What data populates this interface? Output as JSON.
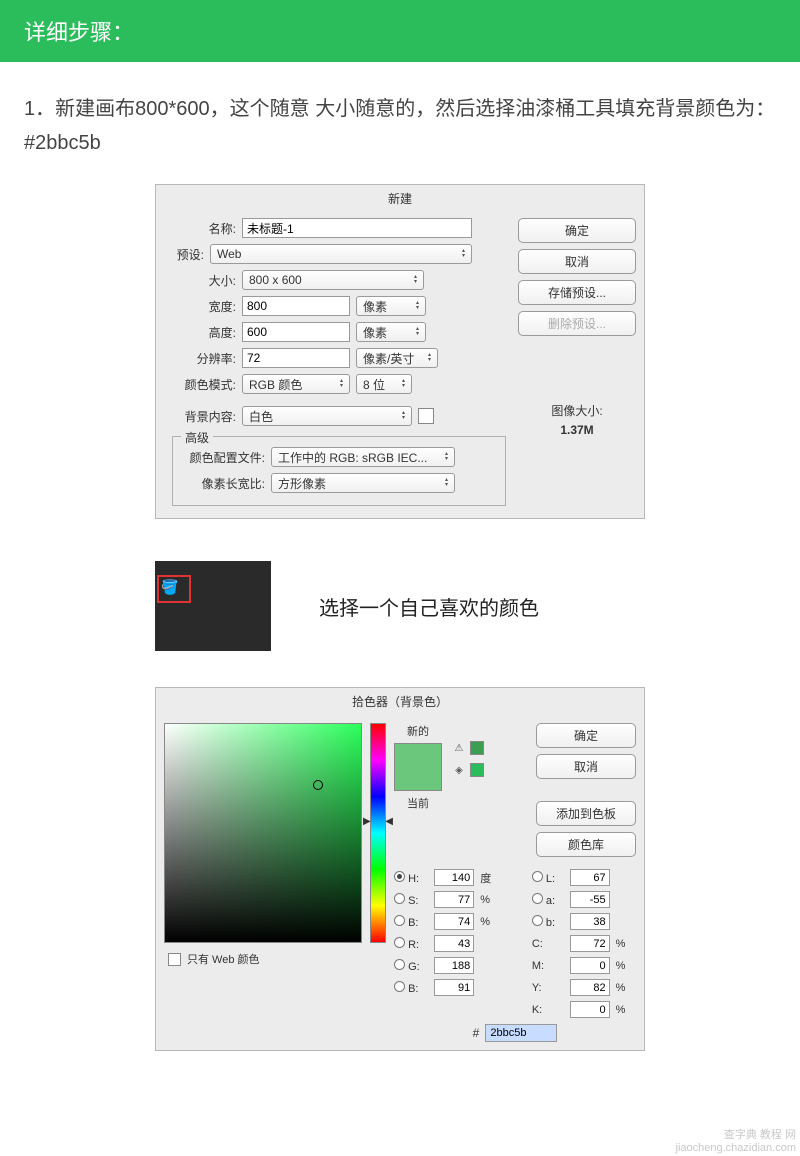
{
  "header": {
    "title": "详细步骤："
  },
  "intro": "1．新建画布800*600，这个随意  大小随意的，然后选择油漆桶工具填充背景颜色为：#2bbc5b",
  "newDialog": {
    "title": "新建",
    "labels": {
      "name": "名称:",
      "preset": "预设:",
      "size": "大小:",
      "width": "宽度:",
      "height": "高度:",
      "res": "分辨率:",
      "mode": "颜色模式:",
      "bg": "背景内容:",
      "advanced": "高级",
      "profile": "颜色配置文件:",
      "aspect": "像素长宽比:",
      "sizeLabel": "图像大小:"
    },
    "values": {
      "name": "未标题-1",
      "preset": "Web",
      "size": "800 x 600",
      "width": "800",
      "widthUnit": "像素",
      "height": "600",
      "heightUnit": "像素",
      "res": "72",
      "resUnit": "像素/英寸",
      "mode": "RGB 颜色",
      "bit": "8 位",
      "bg": "白色",
      "profile": "工作中的 RGB: sRGB IEC...",
      "aspect": "方形像素",
      "sizeVal": "1.37M"
    },
    "buttons": {
      "ok": "确定",
      "cancel": "取消",
      "save": "存储预设...",
      "del": "删除预设..."
    }
  },
  "tool": {
    "caption": "选择一个自己喜欢的颜色"
  },
  "colorPicker": {
    "title": "拾色器（背景色）",
    "buttons": {
      "ok": "确定",
      "cancel": "取消",
      "add": "添加到色板",
      "lib": "颜色库"
    },
    "preview": {
      "new": "新的",
      "current": "当前"
    },
    "labels": {
      "H": "H:",
      "S": "S:",
      "B": "B:",
      "R": "R:",
      "G": "G:",
      "Bb": "B:",
      "L": "L:",
      "a": "a:",
      "b": "b:",
      "C": "C:",
      "M": "M:",
      "Y": "Y:",
      "K": "K:",
      "deg": "度",
      "pct": "%",
      "hash": "#"
    },
    "values": {
      "H": "140",
      "S": "77",
      "B": "74",
      "R": "43",
      "G": "188",
      "Bb": "91",
      "L": "67",
      "a": "-55",
      "b": "38",
      "C": "72",
      "M": "0",
      "Y": "82",
      "K": "0",
      "hex": "2bbc5b"
    },
    "webOnly": "只有 Web 颜色"
  },
  "watermark": {
    "l1": "查字典 教程 网",
    "l2": "jiaocheng.chazidian.com"
  }
}
